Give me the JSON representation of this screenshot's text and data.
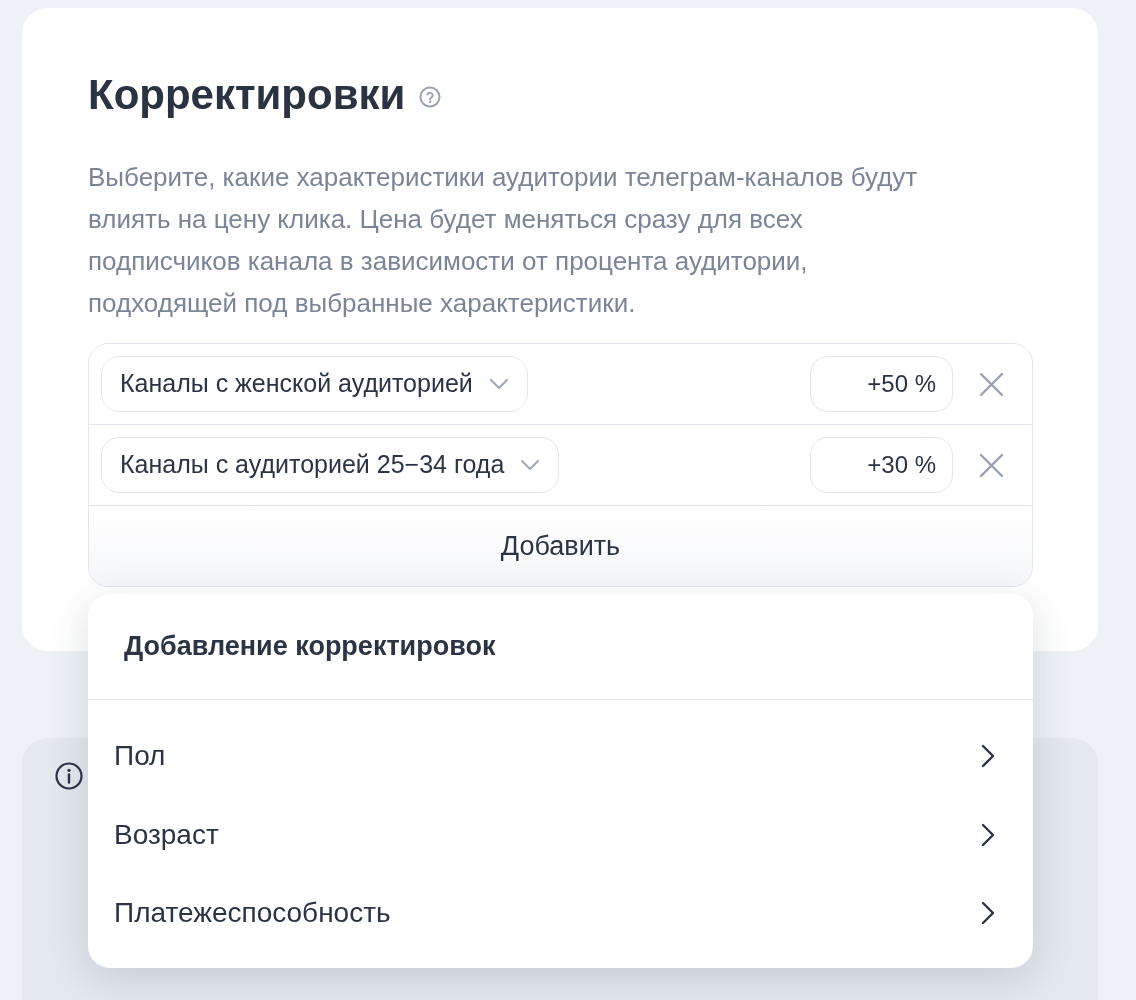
{
  "card": {
    "title": "Корректировки",
    "description": "Выберите, какие характеристики аудитории телеграм-каналов будут влиять на цену клика. Цена будет меняться сразу для всех подписчиков канала в зависимости от процента аудитории, подходящей под выбранные характеристики."
  },
  "adjustments": [
    {
      "category": "Каналы с женской аудиторией",
      "value": "+50 %"
    },
    {
      "category": "Каналы с аудиторией 25−34 года",
      "value": "+30 %"
    }
  ],
  "add_button": "Добавить",
  "popup": {
    "title": "Добавление корректировок",
    "items": [
      {
        "label": "Пол"
      },
      {
        "label": "Возраст"
      },
      {
        "label": "Платежеспособность"
      }
    ]
  }
}
